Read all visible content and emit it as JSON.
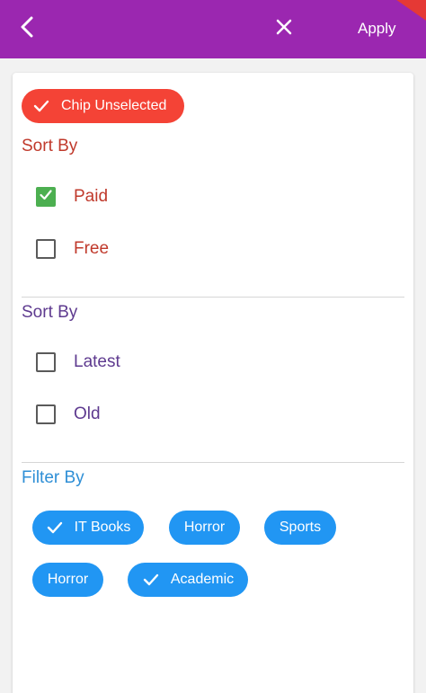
{
  "appbar": {
    "back_icon": "chevron-left-icon",
    "close_icon": "close-icon",
    "apply_label": "Apply",
    "background": "#9b27b0"
  },
  "status_chip": {
    "label": "Chip Unselected",
    "icon": "check-icon",
    "color": "#f44336"
  },
  "sort_section_1": {
    "title": "Sort By",
    "color": "#c0392b",
    "options": [
      {
        "label": "Paid",
        "checked": true
      },
      {
        "label": "Free",
        "checked": false
      }
    ]
  },
  "sort_section_2": {
    "title": "Sort By",
    "color": "#5e3a8f",
    "options": [
      {
        "label": "Latest",
        "checked": false
      },
      {
        "label": "Old",
        "checked": false
      }
    ]
  },
  "filter_section": {
    "title": "Filter By",
    "color": "#2f8fd6",
    "chip_color": "#2196f3",
    "chips": [
      {
        "label": "IT Books",
        "selected": true
      },
      {
        "label": "Horror",
        "selected": false
      },
      {
        "label": "Sports",
        "selected": false
      },
      {
        "label": "Horror",
        "selected": false
      },
      {
        "label": "Academic",
        "selected": true
      }
    ]
  }
}
